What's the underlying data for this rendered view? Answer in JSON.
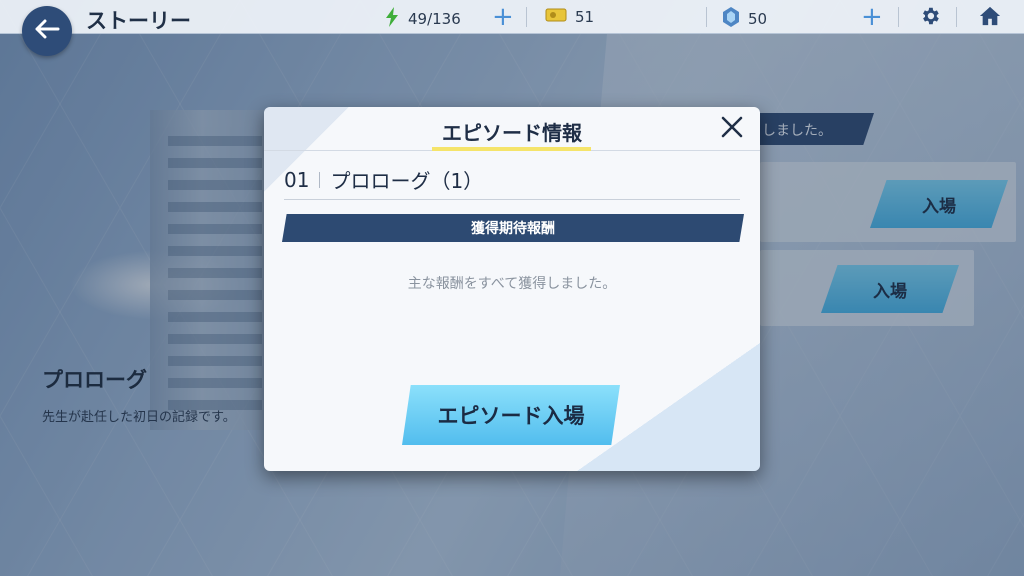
{
  "topbar": {
    "title": "ストーリー",
    "ap": "49/136",
    "credits": "51",
    "gems": "50"
  },
  "background": {
    "banner_text": "しました。",
    "enter_label_1": "入場",
    "enter_label_2": "入場",
    "chapter_title": "プロローグ",
    "chapter_desc": "先生が赴任した初日の記録です。"
  },
  "modal": {
    "title": "エピソード情報",
    "episode_number": "01",
    "episode_title": "プロローグ（1）",
    "reward_header": "獲得期待報酬",
    "reward_message": "主な報酬をすべて獲得しました。",
    "enter_button": "エピソード入場"
  },
  "colors": {
    "accent": "#4a90d6",
    "navy": "#2d4a72",
    "button_cyan": "#52bdee",
    "highlight_yellow": "#f5e46a"
  },
  "icons": {
    "back": "back-arrow-icon",
    "ap": "lightning-icon",
    "credits": "credit-ticket-icon",
    "gems": "gem-icon",
    "settings": "gear-icon",
    "home": "home-icon",
    "close": "close-icon"
  }
}
